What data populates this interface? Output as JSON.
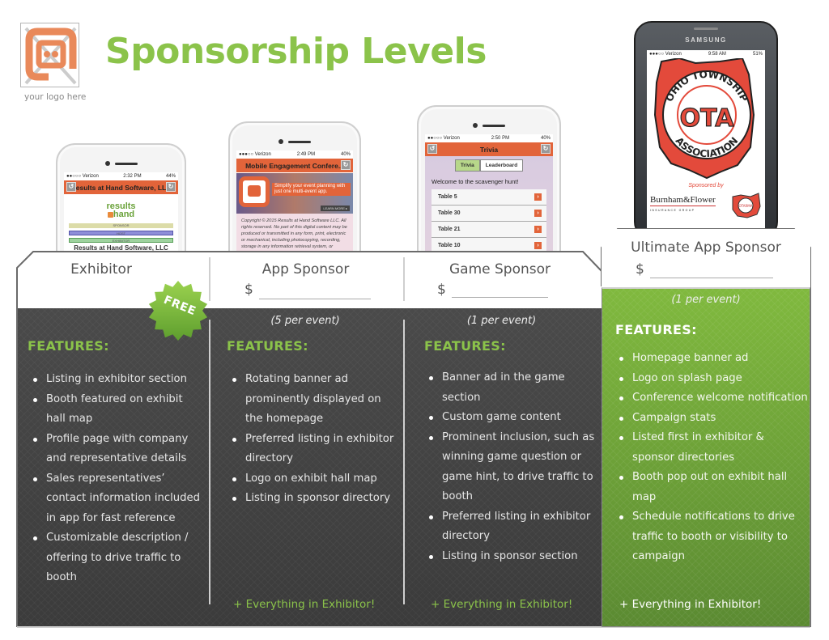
{
  "header": {
    "title": "Sponsorship Levels",
    "logo_caption": "your logo here",
    "logo_icon": "logo-placeholder-icon"
  },
  "colors": {
    "brand_green": "#8bc34a",
    "dark_panel": "#3d3d3d",
    "ultimate_green": "#6a9e3a",
    "app_orange": "#e2643a",
    "ota_red": "#e34a3b"
  },
  "phones": {
    "exhibitor": {
      "status": {
        "carrier": "●●○○○ Verizon",
        "time": "2:32 PM",
        "battery": "44%"
      },
      "app_bar_title": "Results at Hand Software, LLC",
      "logo_line1": "results",
      "logo_line2": "hand",
      "roles": [
        "SPONSOR",
        "HOST",
        "EXHIBITOR"
      ],
      "company": "Results at Hand Software, LLC"
    },
    "app_sponsor": {
      "status": {
        "carrier": "●●●○○ Verizon",
        "time": "2:49 PM",
        "battery": "40%"
      },
      "app_bar_title": "Mobile Engagement Confere...",
      "banner_text_1": "Simplify your event planning with",
      "banner_text_2": "just one multi-event app.",
      "banner_button": "LEARN MORE ▸",
      "copyright": "Copyright © 2015 Results at Hand Software LLC. All rights reserved. No part of this digital content may be produced or transmitted in any form, print, electronic or mechanical, including photocopying, recording, storage in any information retrieval system, or"
    },
    "game_sponsor": {
      "status": {
        "carrier": "●●○○○ Verizon",
        "time": "2:50 PM",
        "battery": "40%"
      },
      "app_bar_title": "Trivia",
      "segments": [
        "Trivia",
        "Leaderboard"
      ],
      "welcome": "Welcome to the scavenger hunt!",
      "tables": [
        "Table 5",
        "Table 30",
        "Table 21",
        "Table 10"
      ]
    },
    "ultimate": {
      "brand": "SAMSUNG",
      "status": {
        "carrier": "●●●○○ Verizon",
        "time": "9:58 AM",
        "battery": "51%"
      },
      "org_top": "OHIO TOWNSHIP",
      "org_bottom": "ASSOCIATION",
      "org_initials": "OTA",
      "sponsored_by": "Sponsored by",
      "sponsor_name": "Burnham&Flower",
      "sponsor_sub": "INSURANCE GROUP",
      "second_sponsor": "OTARMA"
    }
  },
  "tiers": [
    {
      "name": "Exhibitor",
      "badge": "FREE",
      "features_title": "FEATURES:",
      "features": [
        "Listing in exhibitor section",
        "Booth featured on exhibit hall map",
        "Profile page with company and representative details",
        "Sales representatives’ contact information included in app for fast reference",
        "Customizable description / offering to drive traffic to booth"
      ]
    },
    {
      "name": "App Sponsor",
      "price_symbol": "$",
      "price_value": "",
      "availability": "(5 per event)",
      "features_title": "FEATURES:",
      "features": [
        "Rotating banner ad prominently displayed on the homepage",
        "Preferred listing in exhibitor directory",
        "Logo on exhibit hall map",
        "Listing in sponsor directory"
      ],
      "includes": "+ Everything in Exhibitor!"
    },
    {
      "name": "Game Sponsor",
      "price_symbol": "$",
      "price_value": "",
      "availability": "(1 per event)",
      "features_title": "FEATURES:",
      "features": [
        "Banner ad in the game section",
        "Custom game content",
        "Prominent inclusion, such as winning game question or game hint, to drive traffic to booth",
        "Preferred listing in exhibitor directory",
        "Listing in sponsor section"
      ],
      "includes": "+ Everything in Exhibitor!"
    },
    {
      "name": "Ultimate App Sponsor",
      "price_symbol": "$",
      "price_value": "",
      "availability": "(1 per event)",
      "features_title": "FEATURES:",
      "features": [
        "Homepage banner ad",
        "Logo on splash page",
        "Conference welcome notification",
        "Campaign stats",
        "Listed first in exhibitor & sponsor directories",
        "Booth pop out on exhibit hall map",
        "Schedule notifications to drive traffic to booth or visibility to campaign"
      ],
      "includes": "+ Everything in Exhibitor!"
    }
  ]
}
